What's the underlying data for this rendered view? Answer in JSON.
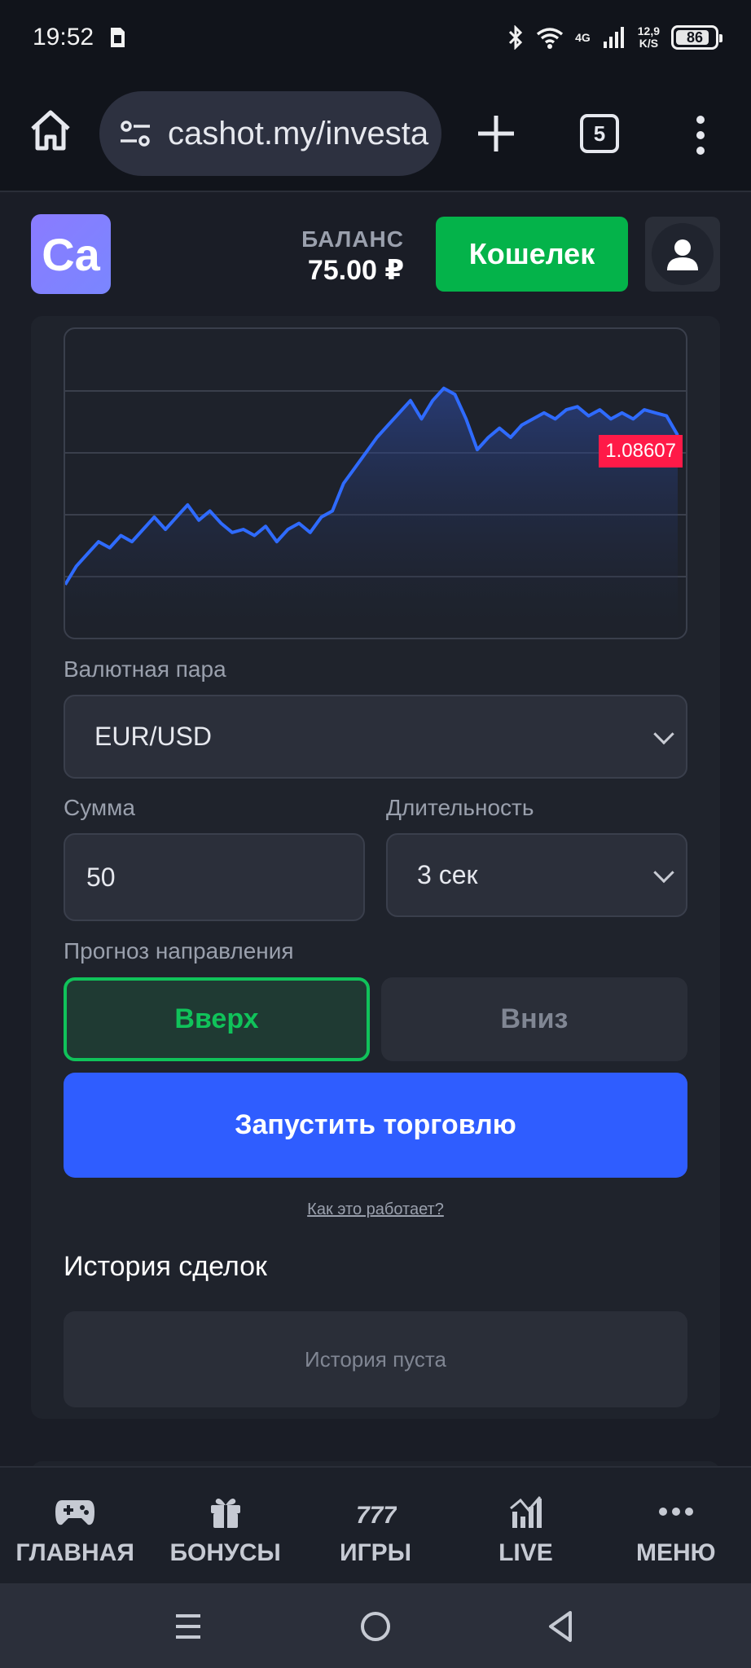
{
  "status_bar": {
    "time": "19:52",
    "network_speed_value": "12,9",
    "network_speed_unit": "K/S",
    "network_type": "4G",
    "battery_percent": "86",
    "battery_level": 0.86
  },
  "browser": {
    "url": "cashot.my/investa",
    "tab_count": "5"
  },
  "header": {
    "logo_text": "Ca",
    "balance_label": "БАЛАНС",
    "balance_value": "75.00 ₽",
    "wallet_button": "Кошелек"
  },
  "chart_data": {
    "type": "area",
    "current_price": "1.08607",
    "line_color": "#2f6bff",
    "marker_color": "#ff1a48",
    "grid": true,
    "values": [
      1.0812,
      1.0818,
      1.0822,
      1.0826,
      1.0824,
      1.0828,
      1.0826,
      1.083,
      1.0834,
      1.083,
      1.0834,
      1.0838,
      1.0833,
      1.0836,
      1.0832,
      1.0829,
      1.083,
      1.0828,
      1.0831,
      1.0826,
      1.083,
      1.0832,
      1.0829,
      1.0834,
      1.0836,
      1.0845,
      1.085,
      1.0855,
      1.086,
      1.0864,
      1.0868,
      1.0872,
      1.0866,
      1.0872,
      1.0876,
      1.0874,
      1.0866,
      1.0856,
      1.086,
      1.0863,
      1.086,
      1.0864,
      1.0866,
      1.0868,
      1.0866,
      1.0869,
      1.087,
      1.0867,
      1.0869,
      1.0866,
      1.0868,
      1.0866,
      1.0869,
      1.0868,
      1.0867,
      1.08607
    ]
  },
  "form": {
    "pair_label": "Валютная пара",
    "pair_value": "EUR/USD",
    "amount_label": "Сумма",
    "amount_value": "50",
    "duration_label": "Длительность",
    "duration_value": "3 сек",
    "direction_label": "Прогноз направления",
    "up_label": "Вверх",
    "down_label": "Вниз",
    "start_button": "Запустить торговлю",
    "how_link": "Как это работает?"
  },
  "history": {
    "title": "История сделок",
    "empty_text": "История пуста"
  },
  "bottom_nav": {
    "items": [
      {
        "label": "ГЛАВНАЯ",
        "icon": "gamepad-icon"
      },
      {
        "label": "БОНУСЫ",
        "icon": "gift-icon"
      },
      {
        "label": "ИГРЫ",
        "icon": "slots-777-icon"
      },
      {
        "label": "LIVE",
        "icon": "live-chart-icon"
      },
      {
        "label": "МЕНЮ",
        "icon": "more-dots-icon"
      }
    ]
  }
}
